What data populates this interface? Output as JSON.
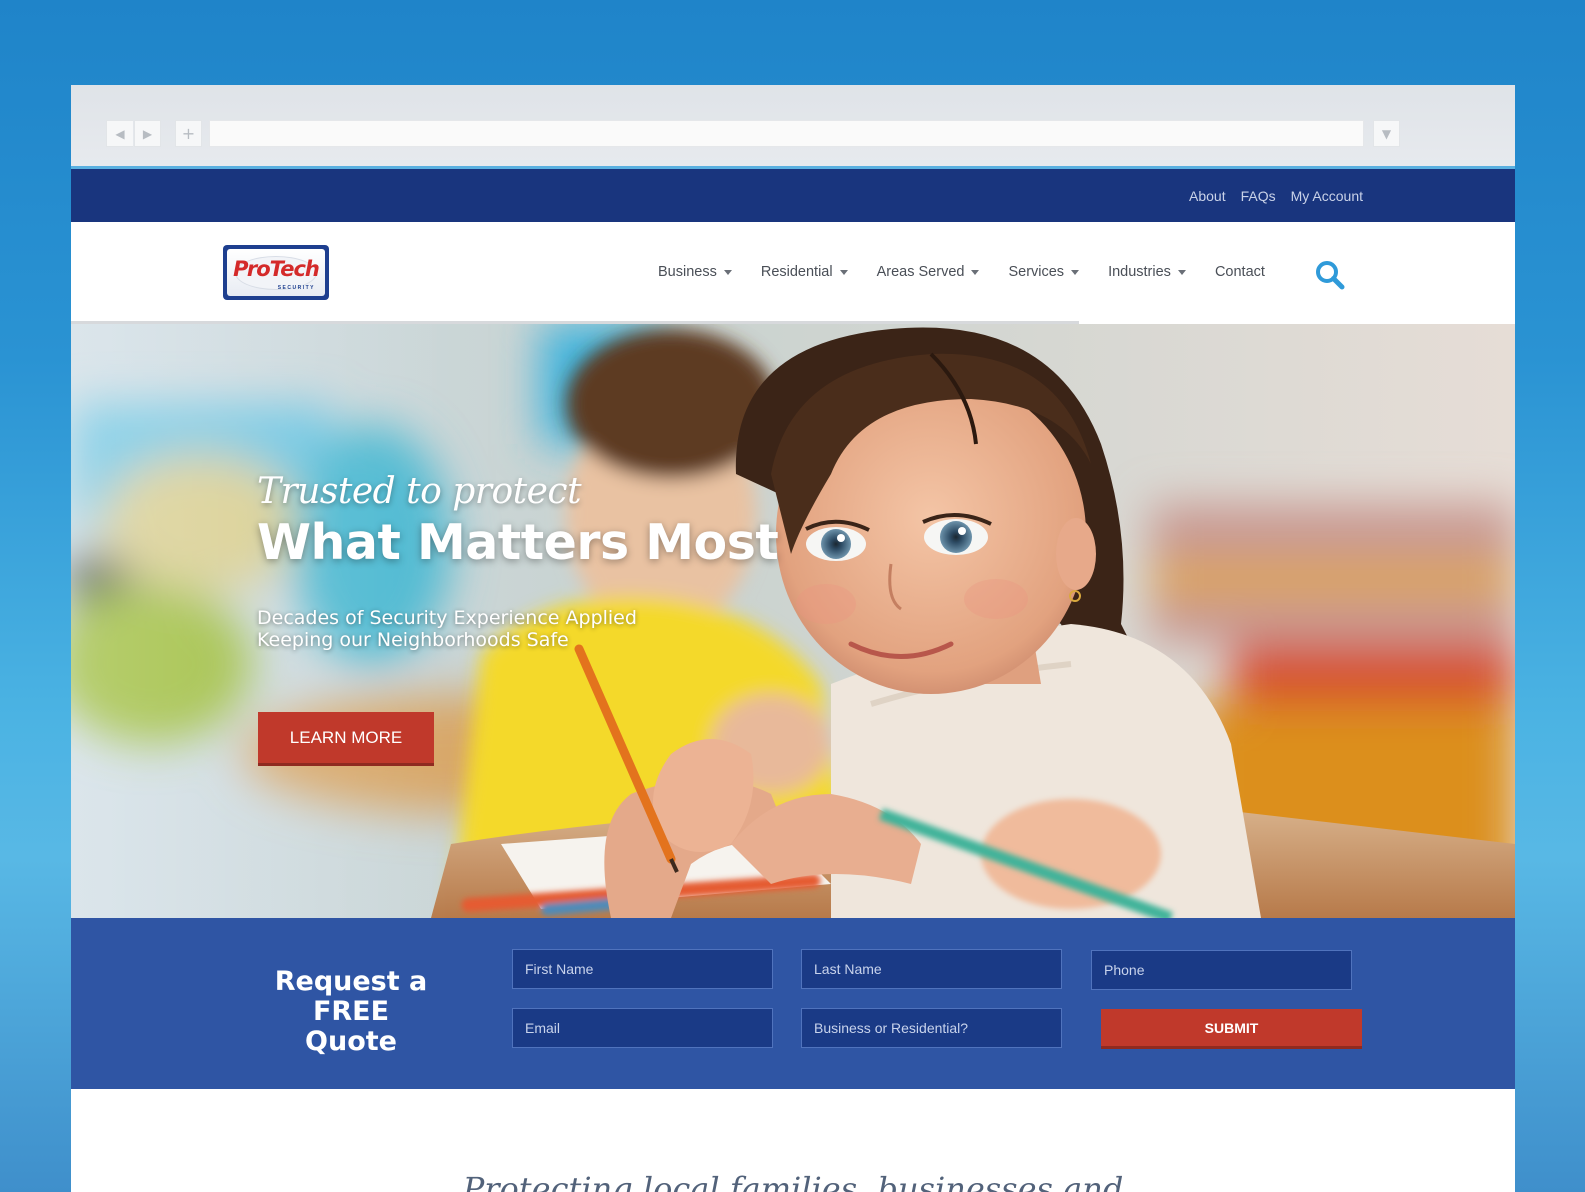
{
  "browser": {
    "back_icon": "◀",
    "forward_icon": "▶",
    "new_tab_icon": "+",
    "menu_icon": "▼"
  },
  "utility_nav": [
    "About",
    "FAQs",
    "My Account"
  ],
  "logo": {
    "text": "ProTech",
    "subtext": "SECURITY"
  },
  "main_nav": [
    {
      "label": "Business",
      "dropdown": true
    },
    {
      "label": "Residential",
      "dropdown": true
    },
    {
      "label": "Areas Served",
      "dropdown": true
    },
    {
      "label": "Services",
      "dropdown": true
    },
    {
      "label": "Industries",
      "dropdown": true
    },
    {
      "label": "Contact",
      "dropdown": false
    }
  ],
  "search": {
    "icon": "search-icon"
  },
  "hero": {
    "tagline": "Trusted to protect",
    "headline": "What Matters Most",
    "subline_1": "Decades of Security Experience Applied",
    "subline_2": "Keeping our Neighborhoods Safe",
    "cta": "LEARN MORE"
  },
  "quote_form": {
    "title_line_1": "Request a FREE",
    "title_line_2": "Quote",
    "first_name_placeholder": "First Name",
    "last_name_placeholder": "Last Name",
    "phone_placeholder": "Phone",
    "email_placeholder": "Email",
    "type_placeholder": "Business or Residential?",
    "submit": "SUBMIT"
  },
  "section_heading": "Protecting local families, businesses and",
  "colors": {
    "utility_bar": "#19357e",
    "quote_bar": "#2f55a4",
    "accent_red": "#c0392b",
    "search_blue": "#2f9ad9"
  }
}
